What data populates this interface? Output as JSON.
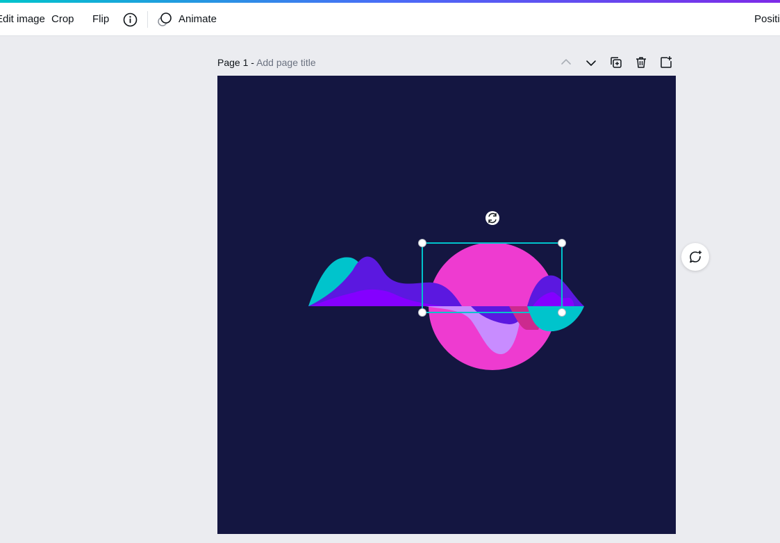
{
  "toolbar": {
    "edit_image_label": "Edit image",
    "crop_label": "Crop",
    "flip_label": "Flip",
    "info_icon": "info-icon",
    "animate_icon": "animate-icon",
    "animate_label": "Animate",
    "position_label": "Position"
  },
  "page": {
    "number_label": "Page 1 -",
    "title_placeholder": "Add page title",
    "actions": [
      "chevron-up-icon",
      "chevron-down-icon",
      "duplicate-page-icon",
      "trash-icon",
      "add-page-icon"
    ]
  },
  "canvas": {
    "background": "#141641",
    "element": "wave-sunset-graphic",
    "selected_element": "pink-sun-circle"
  },
  "side": {
    "comment_icon": "add-comment-icon"
  },
  "colors": {
    "accent_selection": "#00c4cc",
    "sun": "#ee3bd0",
    "wave_violet": "#5b18e0",
    "wave_purple": "#8400ff",
    "wave_cyan": "#00c4cc",
    "wave_lilac": "#c88cff"
  }
}
